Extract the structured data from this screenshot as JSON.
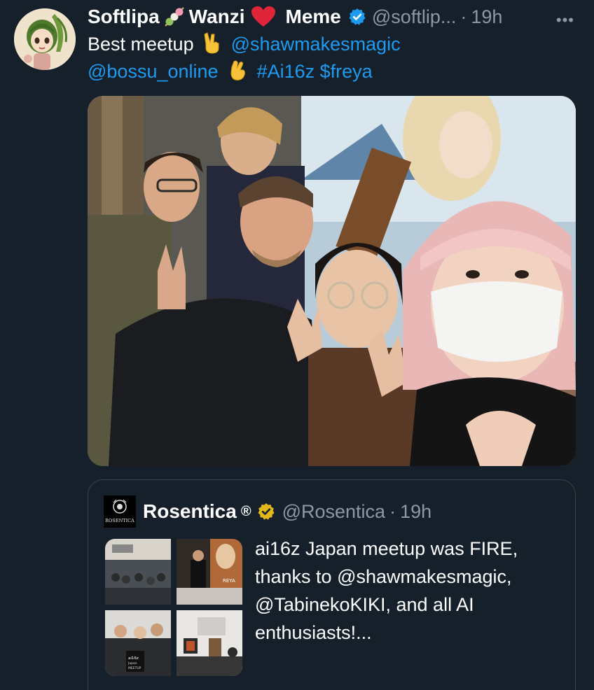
{
  "tweet": {
    "author": {
      "name_part1": "Softlipa",
      "name_part2": "Wanzi",
      "name_part3": "Meme",
      "handle": "@softlip...",
      "time": "19h",
      "avatar_icon": "anime-girl-avatar"
    },
    "more_label": "•••",
    "text": {
      "line1_prefix": "Best meetup",
      "mention1": "@shawmakesmagic",
      "mention2": "@bossu_online",
      "hashtag": "#Ai16z",
      "cashtag": "$freya"
    },
    "photo_icon": "group-selfie-photo"
  },
  "quote": {
    "name": "Rosentica",
    "registered_mark": "®",
    "handle": "@Rosentica",
    "time": "19h",
    "logo_text": "ROSENTICA",
    "text_line1": "ai16z Japan meetup was FIRE,",
    "text_line2": "thanks to @shawmakesmagic,",
    "text_line3": "@TabinekoKIKI, and all AI",
    "text_line4": "enthusiasts!...",
    "thumb_label_1": "REYA",
    "thumb_label_2": "ai16z",
    "thumb_label_3": "Japan",
    "thumb_label_4": "MEETUP"
  },
  "colors": {
    "background": "#15202b",
    "link": "#1d9bf0",
    "muted": "#8b98a5",
    "border": "#38444d",
    "verified_blue": "#1d9bf0",
    "verified_gold": "#e2b719"
  }
}
